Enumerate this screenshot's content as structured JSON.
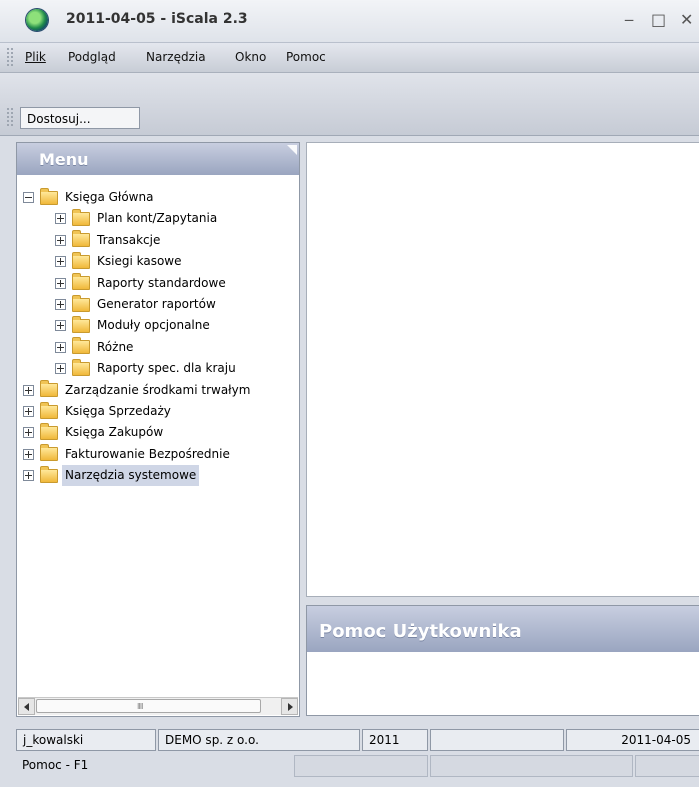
{
  "window": {
    "title": "2011-04-05 - iScala 2.3",
    "controls": {
      "minimize": "‒",
      "maximize": "□",
      "close": "✕"
    }
  },
  "menubar": {
    "items": [
      {
        "label": "Plik",
        "mnemonic": "P"
      },
      {
        "label": "Podgląd",
        "mnemonic": "P"
      },
      {
        "label": "Narzędzia",
        "mnemonic": "N"
      },
      {
        "label": "Okno",
        "mnemonic": "O"
      },
      {
        "label": "Pomoc",
        "mnemonic": "P"
      }
    ]
  },
  "toolbar": {
    "customize_label": "Dostosuj..."
  },
  "menu_panel": {
    "title": "Menu",
    "tree": [
      {
        "label": "Księga Główna",
        "expanded": true,
        "level": 0
      },
      {
        "label": "Plan kont/Zapytania",
        "expanded": false,
        "level": 1
      },
      {
        "label": "Transakcje",
        "expanded": false,
        "level": 1
      },
      {
        "label": "Ksiegi kasowe",
        "expanded": false,
        "level": 1
      },
      {
        "label": "Raporty standardowe",
        "expanded": false,
        "level": 1
      },
      {
        "label": "Generator raportów",
        "expanded": false,
        "level": 1
      },
      {
        "label": "Moduły opcjonalne",
        "expanded": false,
        "level": 1
      },
      {
        "label": "Różne",
        "expanded": false,
        "level": 1
      },
      {
        "label": "Raporty spec. dla kraju",
        "expanded": false,
        "level": 1
      },
      {
        "label": "Zarządzanie środkami trwałym",
        "expanded": false,
        "level": 0
      },
      {
        "label": "Księga Sprzedaży",
        "expanded": false,
        "level": 0
      },
      {
        "label": "Księga Zakupów",
        "expanded": false,
        "level": 0
      },
      {
        "label": "Fakturowanie Bezpośrednie",
        "expanded": false,
        "level": 0
      },
      {
        "label": "Narzędzia systemowe",
        "expanded": false,
        "level": 0,
        "selected": true
      }
    ]
  },
  "help_panel": {
    "title": "Pomoc Użytkownika"
  },
  "status": {
    "user": "j_kowalski",
    "company": "DEMO sp. z o.o.",
    "year": "2011",
    "date": "2011-04-05",
    "help_hint": "Pomoc - F1"
  },
  "colors": {
    "panel_header": "#9aa5c0",
    "selection": "#cfd6e6",
    "folder": "#f0b83a"
  }
}
